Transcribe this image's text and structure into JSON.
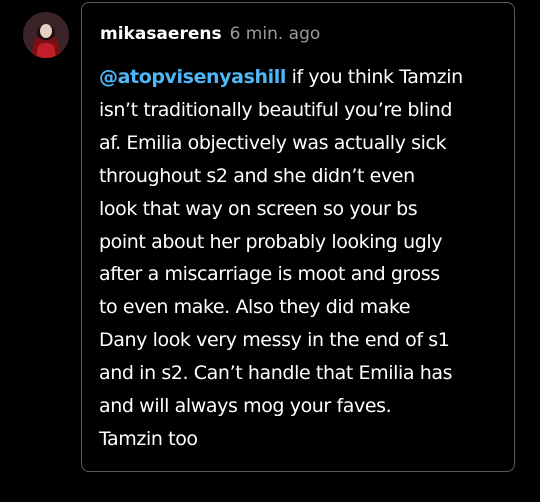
{
  "comment": {
    "username": "mikasaerens",
    "timestamp": "6 min. ago",
    "mention": "@atopvisenyashill",
    "lines": [
      " if you think Tamzin",
      "isn’t traditionally beautiful you’re blind",
      "af. Emilia objectively was actually sick",
      "throughout s2 and she didn’t even",
      "look that way on screen so your bs",
      "point about her probably looking ugly",
      "after a miscarriage is moot and gross",
      "to even make. Also they did make",
      "Dany look very messy in the end of s1",
      "and in s2. Can’t handle that Emilia has",
      "and will always mog your faves.",
      "Tamzin too"
    ]
  },
  "colors": {
    "background": "#000000",
    "card_border": "#5a5a5a",
    "mention": "#4fb6f7",
    "timestamp": "#9a9a9a"
  }
}
